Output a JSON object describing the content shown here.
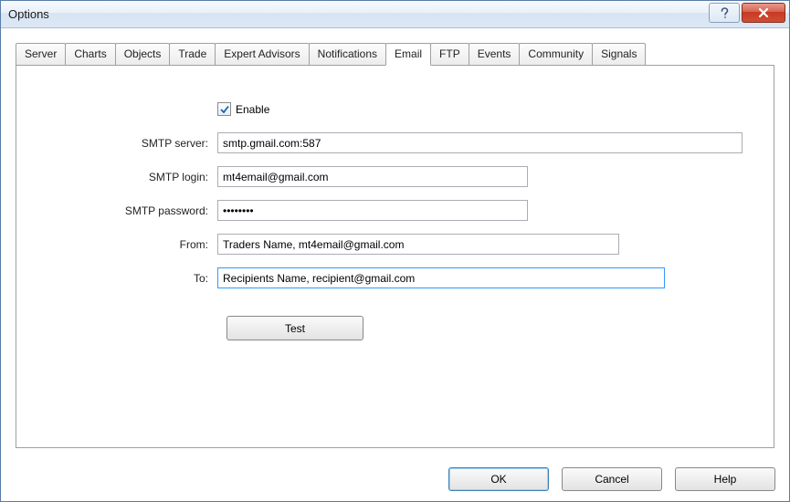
{
  "window": {
    "title": "Options"
  },
  "tabs": [
    {
      "label": "Server"
    },
    {
      "label": "Charts"
    },
    {
      "label": "Objects"
    },
    {
      "label": "Trade"
    },
    {
      "label": "Expert Advisors"
    },
    {
      "label": "Notifications"
    },
    {
      "label": "Email"
    },
    {
      "label": "FTP"
    },
    {
      "label": "Events"
    },
    {
      "label": "Community"
    },
    {
      "label": "Signals"
    }
  ],
  "form": {
    "enable_label": "Enable",
    "enable_checked": true,
    "smtp_server_label": "SMTP server:",
    "smtp_server_value": "smtp.gmail.com:587",
    "smtp_login_label": "SMTP login:",
    "smtp_login_value": "mt4email@gmail.com",
    "smtp_password_label": "SMTP password:",
    "smtp_password_value": "••••••••",
    "from_label": "From:",
    "from_value": "Traders Name, mt4email@gmail.com",
    "to_label": "To:",
    "to_value": "Recipients Name, recipient@gmail.com",
    "test_label": "Test"
  },
  "buttons": {
    "ok": "OK",
    "cancel": "Cancel",
    "help": "Help"
  }
}
